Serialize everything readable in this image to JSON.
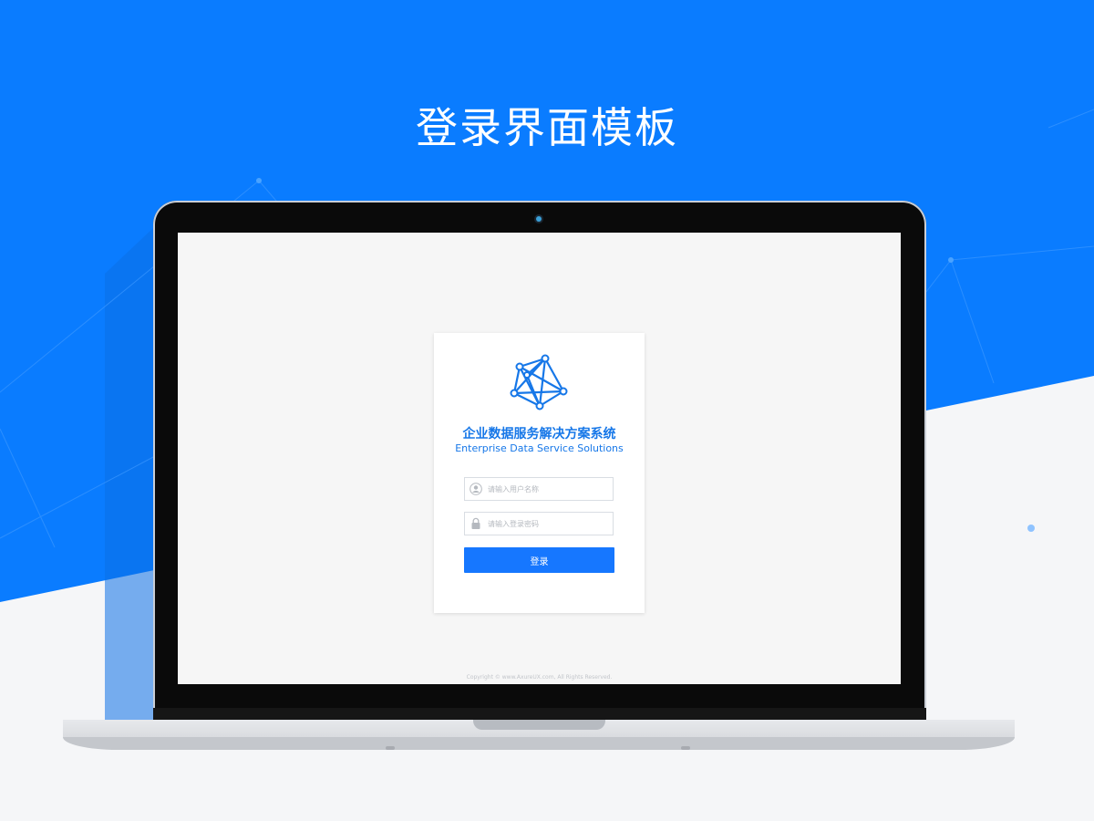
{
  "page": {
    "title": "登录界面模板"
  },
  "login": {
    "brand_cn": "企业数据服务解决方案系统",
    "brand_en": "Enterprise Data Service Solutions",
    "username_placeholder": "请输入用户名称",
    "password_placeholder": "请输入登录密码",
    "submit_label": "登录",
    "copyright": "Copyright © www.AxureUX.com, All Rights Reserved."
  },
  "icons": {
    "logo": "network-logo-icon",
    "username": "user-icon",
    "password": "lock-icon"
  },
  "colors": {
    "background_blue": "#0a7cff",
    "accent_blue": "#1677ff",
    "brand_text": "#1677e8"
  }
}
